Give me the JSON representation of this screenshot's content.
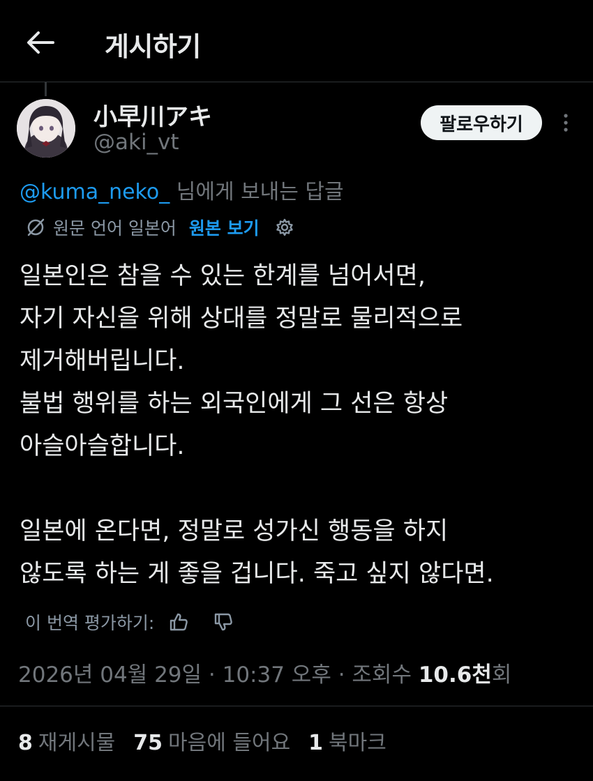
{
  "header": {
    "title": "게시하기",
    "back_icon": "arrow-left-icon"
  },
  "post": {
    "author": {
      "display_name": "小早川アキ",
      "handle": "@aki_vt"
    },
    "follow_label": "팔로우하기",
    "reply_to": {
      "mention": "@kuma_neko_",
      "suffix": " 님에게 보내는 답글"
    },
    "translation": {
      "info": "원문 언어 일본어",
      "show_original": "원본 보기",
      "rate_label": "이 번역 평가하기:"
    },
    "body_lines": [
      "일본인은 참을 수 있는 한계를 넘어서면,",
      "자기 자신을 위해 상대를 정말로 물리적으로",
      "제거해버립니다.",
      "불법 행위를 하는 외국인에게 그 선은 항상",
      "아슬아슬합니다.",
      "",
      "일본에 온다면, 정말로 성가신 행동을 하지",
      "않도록 하는 게 좋을 겁니다. 죽고 싶지 않다면."
    ],
    "meta": {
      "timestamp": "2026년 04월 29일 · 10:37 오후 · 조회수 ",
      "views": "10.6천",
      "views_suffix": "회"
    },
    "stats": {
      "reposts_count": "8",
      "reposts_label": "재게시물",
      "likes_count": "75",
      "likes_label": "마음에 들어요",
      "bookmarks_count": "1",
      "bookmarks_label": "북마크"
    }
  },
  "colors": {
    "background": "#000000",
    "text": "#e7e9ea",
    "muted": "#71767b",
    "accent": "#1d9bf0"
  }
}
